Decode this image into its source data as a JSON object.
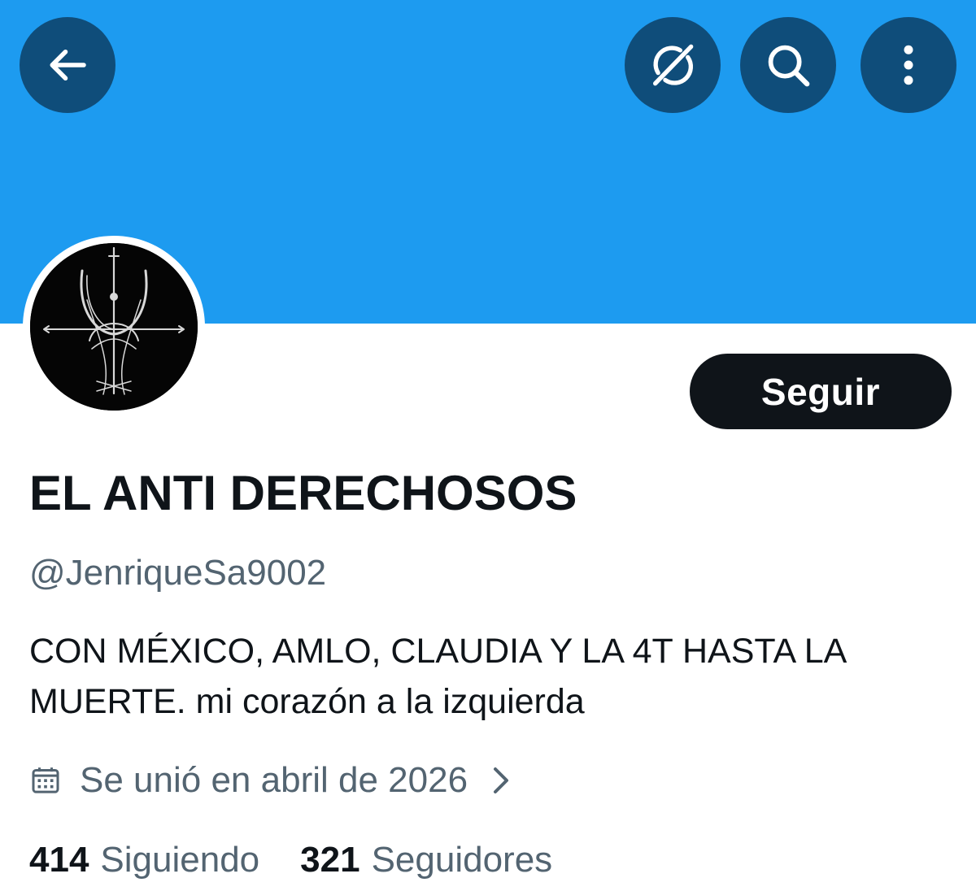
{
  "header": {
    "back_icon": "arrow-left-icon",
    "grok_icon": "grok-icon",
    "search_icon": "search-icon",
    "more_icon": "more-vertical-icon",
    "banner_color": "#1d9bf0"
  },
  "profile": {
    "display_name": "EL ANTI DERECHOSOS",
    "handle": "@JenriqueSa9002",
    "bio": "CON MÉXICO, AMLO, CLAUDIA Y LA 4T HASTA LA MUERTE. mi corazón a la izquierda",
    "joined": "Se unió en abril de 2026",
    "follow_label": "Seguir"
  },
  "stats": {
    "following_count": "414",
    "following_label": "Siguiendo",
    "followers_count": "321",
    "followers_label": "Seguidores"
  }
}
